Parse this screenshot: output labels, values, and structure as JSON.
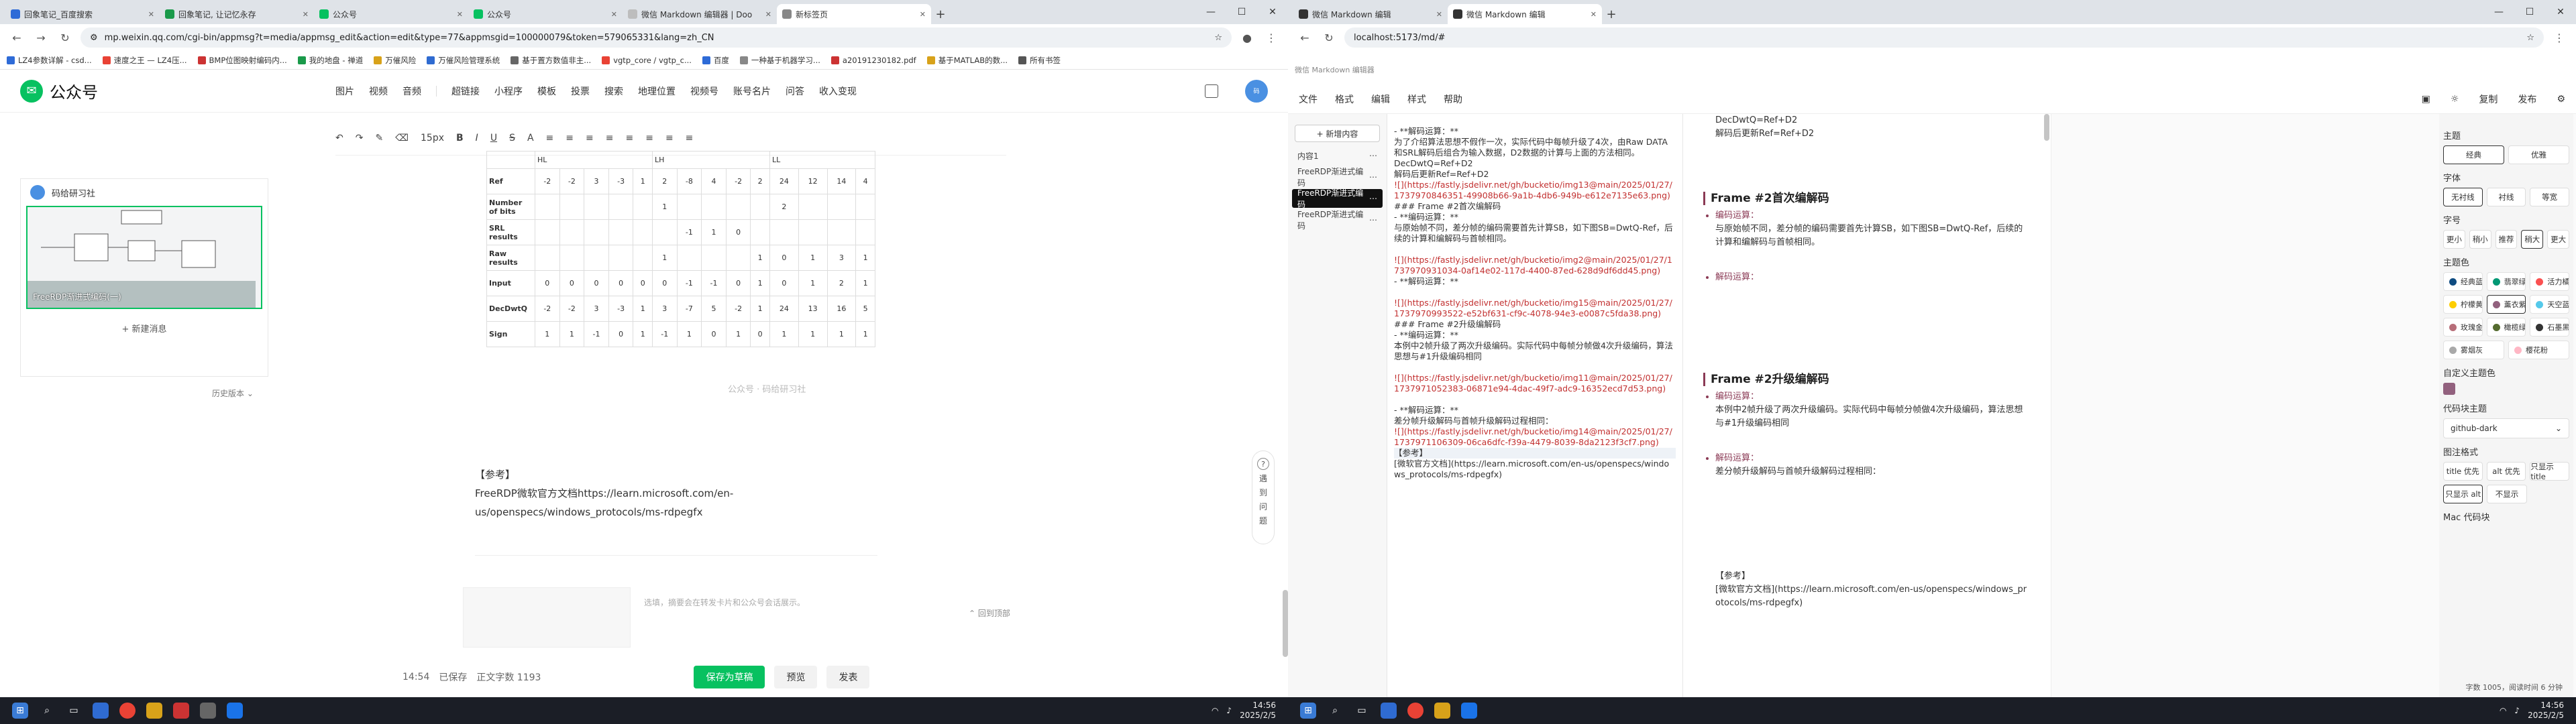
{
  "left": {
    "tabs": [
      {
        "label": "回象笔记_百度搜索",
        "c": "#2e6bd7"
      },
      {
        "label": "回象笔记, 让记忆永存",
        "c": "#1a9a4a"
      },
      {
        "label": "公众号",
        "c": "#07c160"
      },
      {
        "label": "公众号",
        "c": "#07c160"
      },
      {
        "label": "微信 Markdown 编辑器 | Doo",
        "c": "#bdbdbd"
      },
      {
        "label": "新标签页",
        "c": "#888888"
      }
    ],
    "url": "mp.weixin.qq.com/cgi-bin/appmsg?t=media/appmsg_edit&action=edit&type=77&appmsgid=100000079&token=579065331&lang=zh_CN",
    "bookmarks": [
      "LZ4参数详解 - csd...",
      "速度之王 — LZ4压...",
      "BMP位图映射编码内...",
      "我的地盘 - 禅道",
      "万催风险",
      "万催风险管理系统",
      "基于置方数值非主...",
      "vgtp_core / vgtp_c...",
      "百度",
      "一种基于机器学习...",
      "a20191230182.pdf",
      "基于MATLAB的数...",
      "所有书签"
    ],
    "logo": "公众号",
    "nav": [
      "图片",
      "视频",
      "音频",
      "超链接",
      "小程序",
      "模板",
      "投票",
      "搜索",
      "地理位置",
      "视频号",
      "账号名片",
      "问答",
      "收入变现"
    ],
    "toolbar": [
      "15px",
      "B",
      "I",
      "U",
      "S",
      "A"
    ],
    "sidecard": {
      "title": "码给研习社",
      "cap": "FreeRDP渐进式编码(一)",
      "new": "+ 新建消息"
    },
    "history": "历史版本",
    "table": {
      "groups": [
        "HL",
        "LH",
        "LL"
      ],
      "rows": [
        {
          "h": "Ref",
          "v": [
            "-2",
            "-2",
            "3",
            "-3",
            "1",
            "2",
            "-8",
            "4",
            "-2",
            "2",
            "24",
            "12",
            "14",
            "4"
          ]
        },
        {
          "h": "Number of bits",
          "v": [
            "",
            "",
            "",
            "",
            "",
            "1",
            "",
            "",
            "",
            "",
            "2",
            "",
            "",
            ""
          ]
        },
        {
          "h": "SRL results",
          "v": [
            "",
            "",
            "",
            "",
            "",
            "",
            "-1",
            "1",
            "0",
            "",
            "",
            "",
            "",
            ""
          ]
        },
        {
          "h": "Raw results",
          "v": [
            "",
            "",
            "",
            "",
            "",
            "1",
            "",
            "",
            "",
            "1",
            "0",
            "1",
            "3",
            "1"
          ]
        },
        {
          "h": "Input",
          "v": [
            "0",
            "0",
            "0",
            "0",
            "0",
            "0",
            "-1",
            "-1",
            "0",
            "1",
            "0",
            "1",
            "2",
            "1"
          ]
        },
        {
          "h": "DecDwtQ",
          "v": [
            "-2",
            "-2",
            "3",
            "-3",
            "1",
            "3",
            "-7",
            "5",
            "-2",
            "1",
            "24",
            "13",
            "16",
            "5"
          ]
        },
        {
          "h": "Sign",
          "v": [
            "1",
            "1",
            "-1",
            "0",
            "1",
            "-1",
            "1",
            "0",
            "1",
            "0",
            "1",
            "1",
            "1",
            "1"
          ]
        }
      ]
    },
    "watermark": "公众号 · 码给研习社",
    "ref": {
      "title": "【参考】",
      "body": "FreeRDP微软官方文档https://learn.microsoft.com/en-us/openspecs/windows_protocols/ms-rdpegfx"
    },
    "cardtext": "选填，摘要会在转发卡片和公众号会话展示。",
    "totop": "回到顶部",
    "help": [
      "遇",
      "到",
      "问",
      "题"
    ],
    "footer": {
      "time": "14:54",
      "saved": "已保存",
      "count": "正文字数 1193",
      "save": "保存为草稿",
      "preview": "预览",
      "publish": "发表"
    },
    "clock": {
      "t": "14:56",
      "d": "2025/2/5"
    }
  },
  "right": {
    "tabs": [
      {
        "label": "微信 Markdown 编辑",
        "c": "#333333"
      },
      {
        "label": "微信 Markdown 编辑",
        "c": "#333333"
      }
    ],
    "url": "localhost:5173/md/#",
    "subtitle": "微信 Markdown 编辑器",
    "menu": [
      "文件",
      "格式",
      "编辑",
      "样式",
      "帮助"
    ],
    "menu_right": [
      "复制",
      "发布"
    ],
    "newdoc": "+ 新增内容",
    "docs": [
      "内容1",
      "FreeRDP渐进式编码",
      "FreeRDP渐进式编码",
      "FreeRDP渐进式编码"
    ],
    "editor": [
      {
        "t": "- **解码运算：**",
        "c": ""
      },
      {
        "t": "为了介绍算法思想不假作一次，实际代码中每帧升级了4次，由Raw DATA和SRL解码后组合为输入数据，D2数据的计算与上面的方法相同。",
        "c": ""
      },
      {
        "t": "DecDwtQ=Ref+D2",
        "c": ""
      },
      {
        "t": "解码后更新Ref=Ref+D2",
        "c": ""
      },
      {
        "t": "![](https://fastly.jsdelivr.net/gh/bucketio/img13@main/2025/01/27/1737970846351-49908b66-9a1b-4db6-949b-e612e7135e63.png)",
        "c": "ln"
      },
      {
        "t": "### Frame #2首次编解码",
        "c": ""
      },
      {
        "t": "- **编码运算：**",
        "c": ""
      },
      {
        "t": "与原始帧不同，差分帧的编码需要首先计算SB，如下图SB=DwtQ-Ref，后续的计算和编解码与首帧相同。",
        "c": ""
      },
      {
        "t": "",
        "c": ""
      },
      {
        "t": "![](https://fastly.jsdelivr.net/gh/bucketio/img2@main/2025/01/27/1737970931034-0af14e02-117d-4400-87ed-628d9df6dd45.png)",
        "c": "ln"
      },
      {
        "t": "- **解码运算：**",
        "c": ""
      },
      {
        "t": "",
        "c": ""
      },
      {
        "t": "![](https://fastly.jsdelivr.net/gh/bucketio/img15@main/2025/01/27/1737970993522-e52bf631-cf9c-4078-94e3-e0087c5fda38.png)",
        "c": "ln"
      },
      {
        "t": "### Frame #2升级编解码",
        "c": ""
      },
      {
        "t": "- **编码运算：**",
        "c": ""
      },
      {
        "t": "本例中2帧升级了两次升级编码。实际代码中每帧分帧做4次升级编码，算法思想与#1升级编码相同",
        "c": ""
      },
      {
        "t": "",
        "c": ""
      },
      {
        "t": "![](https://fastly.jsdelivr.net/gh/bucketio/img11@main/2025/01/27/1737971052383-06871e94-4dac-49f7-adc9-16352ecd7d53.png)",
        "c": "ln"
      },
      {
        "t": "",
        "c": ""
      },
      {
        "t": "- **解码运算：**",
        "c": ""
      },
      {
        "t": "差分帧升级解码与首帧升级解码过程相同：",
        "c": ""
      },
      {
        "t": "![](https://fastly.jsdelivr.net/gh/bucketio/img14@main/2025/01/27/1737971106309-06ca6dfc-f39a-4479-8039-8da2123f3cf7.png)",
        "c": "ln"
      },
      {
        "t": "【参考】",
        "c": "hl"
      },
      {
        "t": "[微软官方文档](https://learn.microsoft.com/en-us/openspecs/windows_protocols/ms-rdpegfx)",
        "c": ""
      }
    ],
    "preview": {
      "top": [
        "DecDwtQ=Ref+D2",
        "解码后更新Ref=Ref+D2"
      ],
      "h1": "Frame #2首次编解码",
      "enc": "编码运算：",
      "enc_text": "与原始帧不同，差分帧的编码需要首先计算SB，如下图SB=DwtQ-Ref，后续的计算和编解码与首帧相同。",
      "dec": "解码运算：",
      "h2": "Frame #2升级编解码",
      "enc2_text": "本例中2帧升级了两次升级编码。实际代码中每帧分帧做4次升级编码，算法思想与#1升级编码相同",
      "dec2_text": "差分帧升级解码与首帧升级解码过程相同：",
      "ref": "【参考】",
      "ref_link": "[微软官方文档](https://learn.microsoft.com/en-us/openspecs/windows_protocols/ms-rdpegfx)"
    },
    "settings": {
      "theme": "主题",
      "themes": [
        "经典",
        "优雅"
      ],
      "font": "字体",
      "fonts": [
        "无衬线",
        "衬线",
        "等宽"
      ],
      "size": "字号",
      "sizes": [
        "更小",
        "稍小",
        "推荐",
        "稍大",
        "更大"
      ],
      "color": "主题色",
      "colors": [
        {
          "n": "经典蓝",
          "c": "#0f4c81"
        },
        {
          "n": "翡翠绿",
          "c": "#009874"
        },
        {
          "n": "活力橘",
          "c": "#fa5151"
        },
        {
          "n": "柠檬黄",
          "c": "#fece00"
        },
        {
          "n": "薰衣紫",
          "c": "#92617e"
        },
        {
          "n": "天空蓝",
          "c": "#55c9ea"
        },
        {
          "n": "玫瑰金",
          "c": "#b76e79"
        },
        {
          "n": "橄榄绿",
          "c": "#556b2f"
        },
        {
          "n": "石墨黑",
          "c": "#333333"
        },
        {
          "n": "雾烟灰",
          "c": "#a9a9a9"
        },
        {
          "n": "樱花粉",
          "c": "#ffb7c5"
        }
      ],
      "custom": "自定义主题色",
      "codetheme": "代码块主题",
      "code": "github-dark",
      "caption": "图注格式",
      "captions": [
        "title 优先",
        "alt 优先",
        "只显示 title",
        "只显示 alt",
        "不显示"
      ],
      "mac": "Mac 代码块"
    },
    "footer": "字数 1005，阅读时间 6 分钟",
    "clock": {
      "t": "14:56",
      "d": "2025/2/5"
    }
  }
}
